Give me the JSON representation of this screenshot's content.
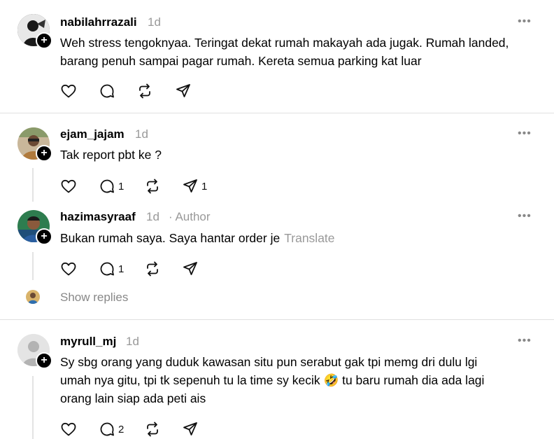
{
  "posts": [
    {
      "username": "nabilahrrazali",
      "time": "1d",
      "more": "•••",
      "lines": [
        "Weh stress tengoknyaa. Teringat dekat rumah makayah ada jugak. Rumah landed,",
        "barang penuh sampai pagar rumah. Kereta semua parking kat luar"
      ],
      "actions": {
        "likes": "",
        "replies": "",
        "reposts": "",
        "shares": ""
      }
    },
    {
      "username": "ejam_jajam",
      "time": "1d",
      "more": "•••",
      "lines": [
        "Tak report pbt ke ?"
      ],
      "actions": {
        "likes": "",
        "replies": "1",
        "reposts": "",
        "shares": "1"
      }
    },
    {
      "username": "hazimasyraaf",
      "time": "1d",
      "author_tag": "· Author",
      "more": "•••",
      "text": "Bukan rumah saya. Saya hantar order je",
      "translate": "Translate",
      "actions": {
        "likes": "",
        "replies": "1",
        "reposts": "",
        "shares": ""
      }
    },
    {
      "username": "myrull_mj",
      "time": "1d",
      "more": "•••",
      "lines": [
        "Sy sbg orang yang duduk kawasan situ pun serabut gak tpi memg dri dulu lgi",
        "umah nya gitu, tpi tk sepenuh tu la time sy kecik 🤣  tu baru rumah dia ada lagi",
        "orang lain siap ada peti ais"
      ],
      "actions": {
        "likes": "",
        "replies": "2",
        "reposts": "",
        "shares": ""
      }
    }
  ],
  "show_replies": "Show replies",
  "colors": {
    "text": "#000000",
    "muted": "#999999",
    "divider": "#e0e0e0",
    "thread": "#e3e3e3"
  }
}
